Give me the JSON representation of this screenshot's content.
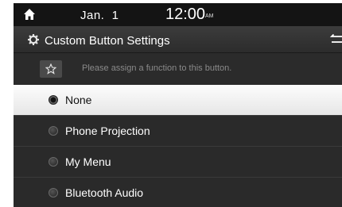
{
  "statusbar": {
    "date": "Jan.  1",
    "time": "12:00",
    "ampm": "AM",
    "home_icon": "home-icon"
  },
  "header": {
    "title": "Custom Button Settings",
    "settings_icon": "gear-icon",
    "back_icon": "back-arrow-icon"
  },
  "hint": {
    "text": "Please assign a function to this button.",
    "icon": "star-icon"
  },
  "options": [
    {
      "label": "None",
      "selected": true
    },
    {
      "label": "Phone Projection",
      "selected": false
    },
    {
      "label": "My Menu",
      "selected": false
    },
    {
      "label": "Bluetooth Audio",
      "selected": false
    }
  ]
}
